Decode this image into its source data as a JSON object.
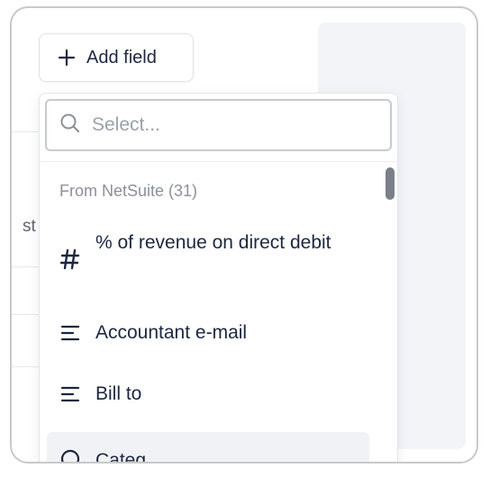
{
  "add_field_button": {
    "label": "Add field",
    "icon": "plus-icon"
  },
  "background": {
    "partial_text": "st"
  },
  "dropdown": {
    "search": {
      "placeholder": "Select...",
      "value": "",
      "icon": "search-icon"
    },
    "group": {
      "label": "From NetSuite (31)"
    },
    "items": [
      {
        "label": "% of revenue on direct debit",
        "icon": "hash-icon"
      },
      {
        "label": "Accountant e-mail",
        "icon": "text-lines-icon"
      },
      {
        "label": "Bill to",
        "icon": "text-lines-icon"
      },
      {
        "label": "Categ",
        "icon": "circle-icon"
      }
    ]
  },
  "colors": {
    "text": "#1c2740",
    "muted": "#8c909a",
    "panel": "#f3f4f8",
    "highlight": "#f1f2f5",
    "scrollbar": "#7b7f8a"
  }
}
